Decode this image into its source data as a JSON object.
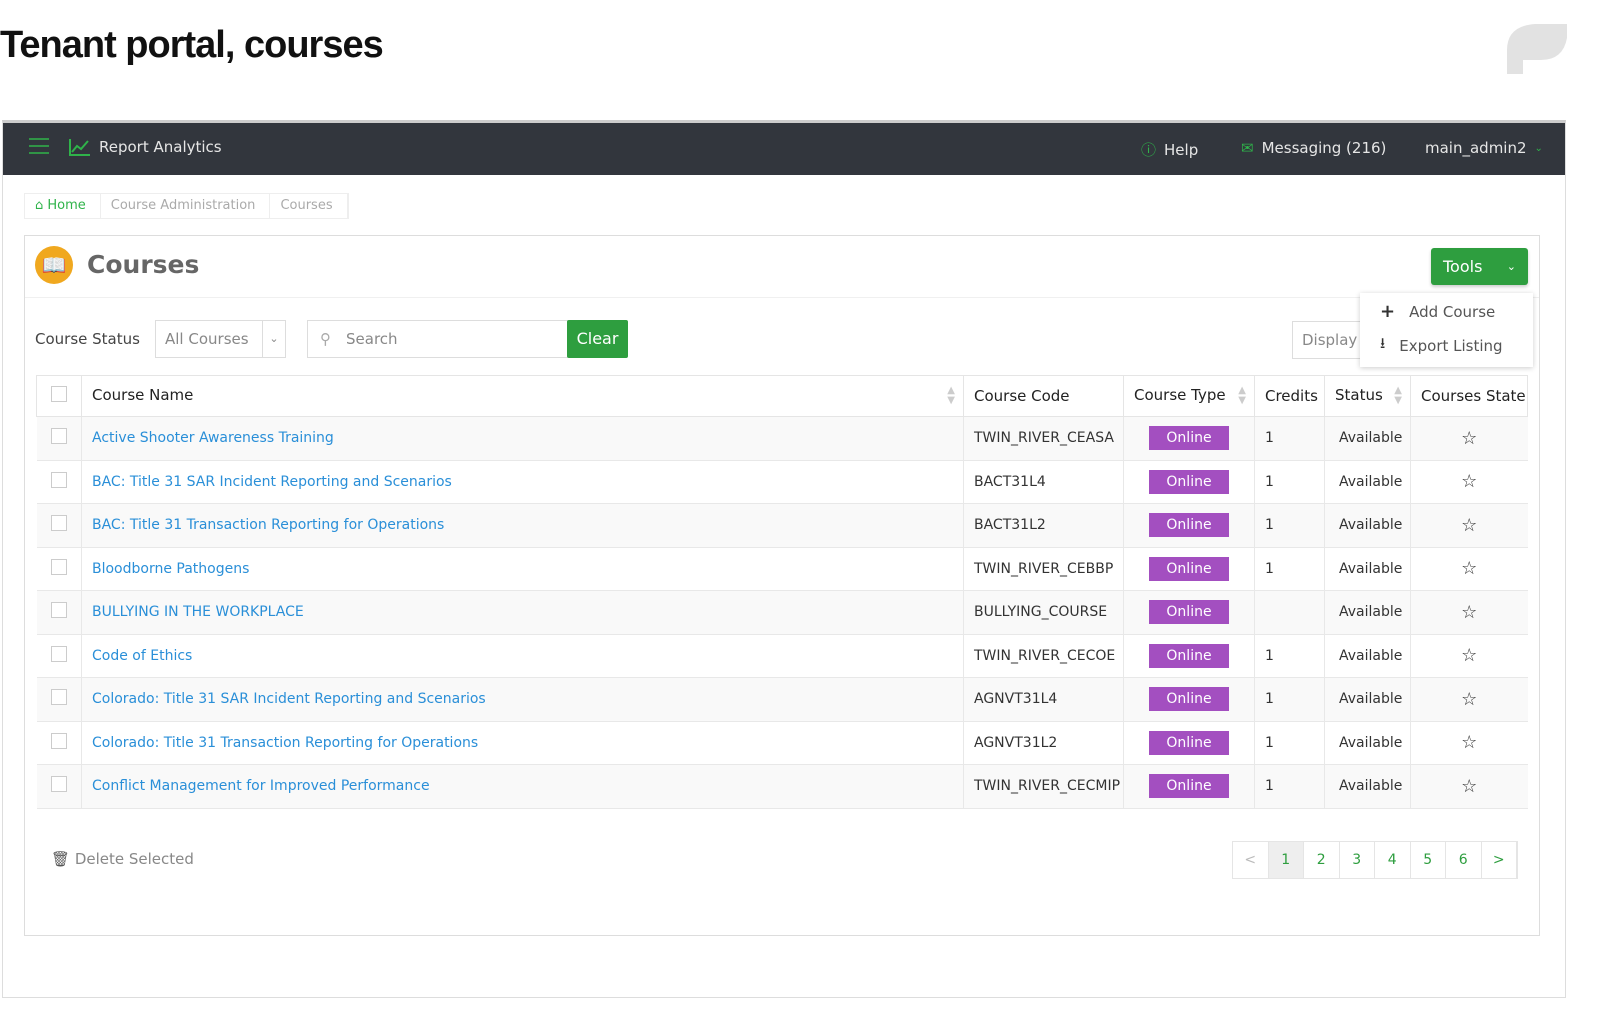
{
  "page_title": "Tenant portal, courses",
  "nav": {
    "brand": "Report Analytics",
    "help": "Help",
    "messaging": "Messaging (216)",
    "user": "main_admin2"
  },
  "breadcrumb": [
    "Home",
    "Course Administration",
    "Courses"
  ],
  "panel": {
    "title": "Courses",
    "tools": "Tools",
    "menu": [
      "Add Course",
      "Export Listing"
    ]
  },
  "filters": {
    "status_label": "Course Status",
    "status_value": "All Courses",
    "search_placeholder": "Search",
    "clear": "Clear",
    "display": "Display"
  },
  "table": {
    "headers": [
      "Course Name",
      "Course Code",
      "Course Type",
      "Credits",
      "Status",
      "Courses State"
    ],
    "rows": [
      [
        "Active Shooter Awareness Training",
        "TWIN_RIVER_CEASA",
        "Online",
        "1",
        "Available"
      ],
      [
        "BAC: Title 31 SAR Incident Reporting and Scenarios",
        "BACT31L4",
        "Online",
        "1",
        "Available"
      ],
      [
        "BAC: Title 31 Transaction Reporting for Operations",
        "BACT31L2",
        "Online",
        "1",
        "Available"
      ],
      [
        "Bloodborne Pathogens",
        "TWIN_RIVER_CEBBP",
        "Online",
        "1",
        "Available"
      ],
      [
        "BULLYING IN THE WORKPLACE",
        "BULLYING_COURSE",
        "Online",
        "",
        "Available"
      ],
      [
        "Code of Ethics",
        "TWIN_RIVER_CECOE",
        "Online",
        "1",
        "Available"
      ],
      [
        "Colorado: Title 31 SAR Incident Reporting and Scenarios",
        "AGNVT31L4",
        "Online",
        "1",
        "Available"
      ],
      [
        "Colorado: Title 31 Transaction Reporting for Operations",
        "AGNVT31L2",
        "Online",
        "1",
        "Available"
      ],
      [
        "Conflict Management for Improved Performance",
        "TWIN_RIVER_CECMIP",
        "Online",
        "1",
        "Available"
      ]
    ]
  },
  "footer": {
    "delete": "Delete Selected",
    "pages": [
      "<",
      "1",
      "2",
      "3",
      "4",
      "5",
      "6",
      ">"
    ],
    "current_page": "1"
  },
  "colors": {
    "nav": "#32363d",
    "accent": "#2e9e3f",
    "badge": "#a34fc0",
    "link": "#2a8fd8"
  }
}
